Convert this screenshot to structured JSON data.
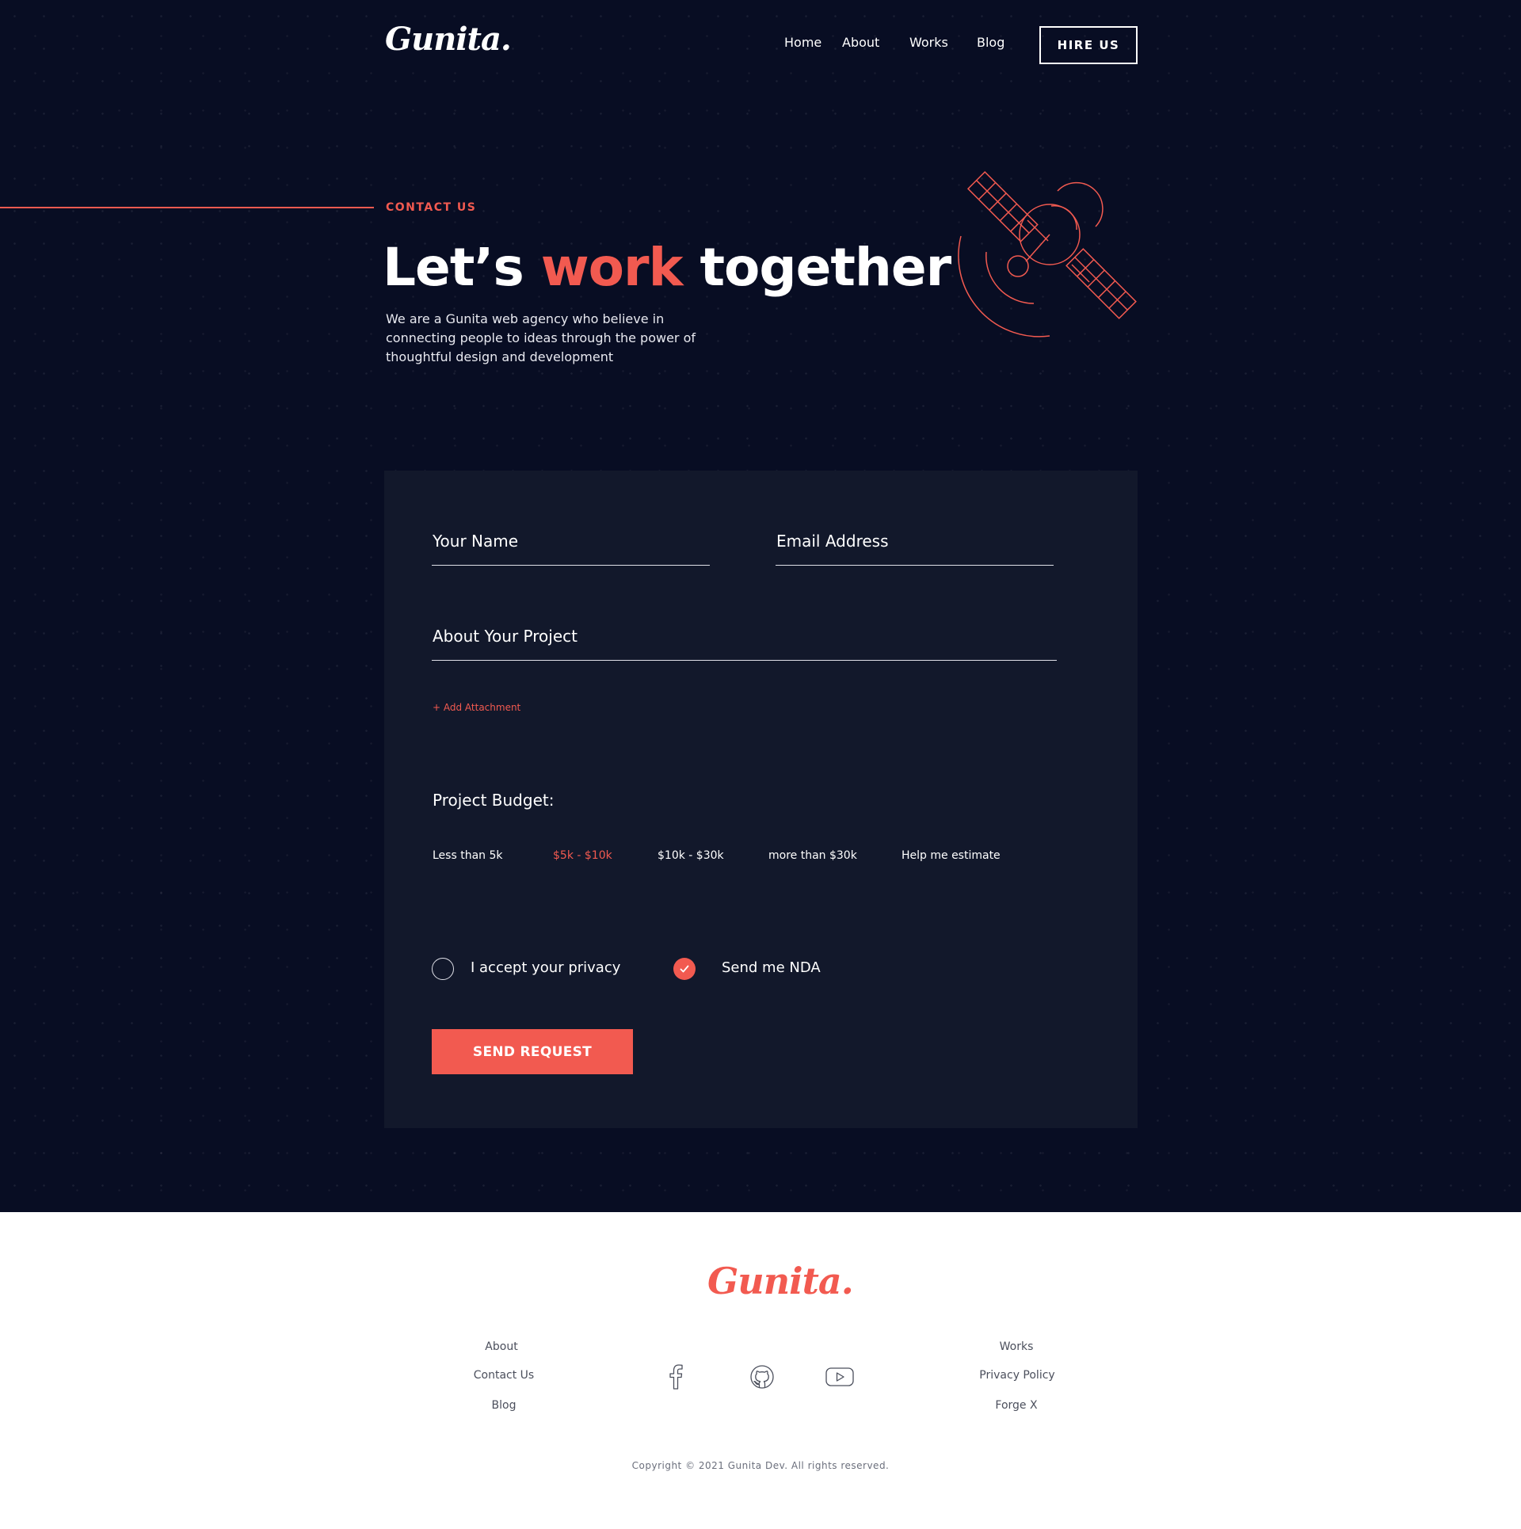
{
  "brand": {
    "name": "Gunita",
    "dot": "."
  },
  "nav": {
    "home": "Home",
    "about": "About",
    "works": "Works",
    "blog": "Blog",
    "hire": "HIRE US"
  },
  "hero": {
    "eyebrow": "CONTACT US",
    "headline_pre": "Let’s ",
    "headline_highlight": "work",
    "headline_post": " together",
    "intro": "We are a Gunita web agency who believe in connecting people to ideas through the power of thoughtful design and development"
  },
  "form": {
    "name_label": "Your Name",
    "email_label": "Email Address",
    "project_label": "About Your Project",
    "attachment": "+ Add Attachment",
    "budget_label": "Project Budget:",
    "budget_options": [
      "Less than 5k",
      "$5k - $10k",
      "$10k - $30k",
      "more than $30k",
      "Help me estimate"
    ],
    "budget_selected": "$5k - $10k",
    "privacy_label": "I accept your privacy",
    "privacy_checked": false,
    "nda_label": "Send me NDA",
    "nda_checked": true,
    "submit": "SEND REQUEST"
  },
  "footer": {
    "left_links": [
      "About",
      "Contact Us",
      "Blog"
    ],
    "right_links": [
      "Works",
      "Privacy Policy",
      "Forge X"
    ],
    "social_icons": [
      "facebook-icon",
      "github-icon",
      "youtube-icon"
    ],
    "copyright": "Copyright © 2021 Gunita Dev. All rights reserved."
  },
  "colors": {
    "accent": "#f25a50",
    "background": "#080d23",
    "card": "#12182b"
  }
}
